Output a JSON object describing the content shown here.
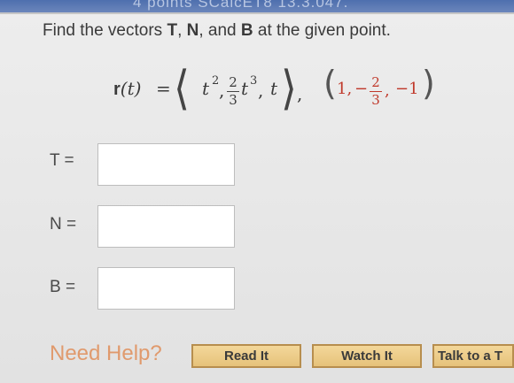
{
  "header": {
    "text": "4 points SCalcET8 13.3.047."
  },
  "question": {
    "prefix": "Find the vectors ",
    "T": "T",
    "sep1": ", ",
    "N": "N",
    "sep2": ", and ",
    "B": "B",
    "suffix": " at the given point."
  },
  "formula": {
    "r": "r",
    "t_arg": "(t)",
    "equals": "=",
    "t": "t",
    "exp2": "2",
    "comma": ",",
    "num2": "2",
    "den3": "3",
    "exp3": "3",
    "t_last": "t",
    "point_1": "1,",
    "minus": "−",
    "pnum": "2",
    "pden": "3",
    "pcomma": ",",
    "pneg": "−1"
  },
  "answers": [
    {
      "label": "T ="
    },
    {
      "label": "N ="
    },
    {
      "label": "B ="
    }
  ],
  "help": {
    "label": "Need Help?",
    "buttons": [
      "Read It",
      "Watch It",
      "Talk to a T"
    ]
  }
}
